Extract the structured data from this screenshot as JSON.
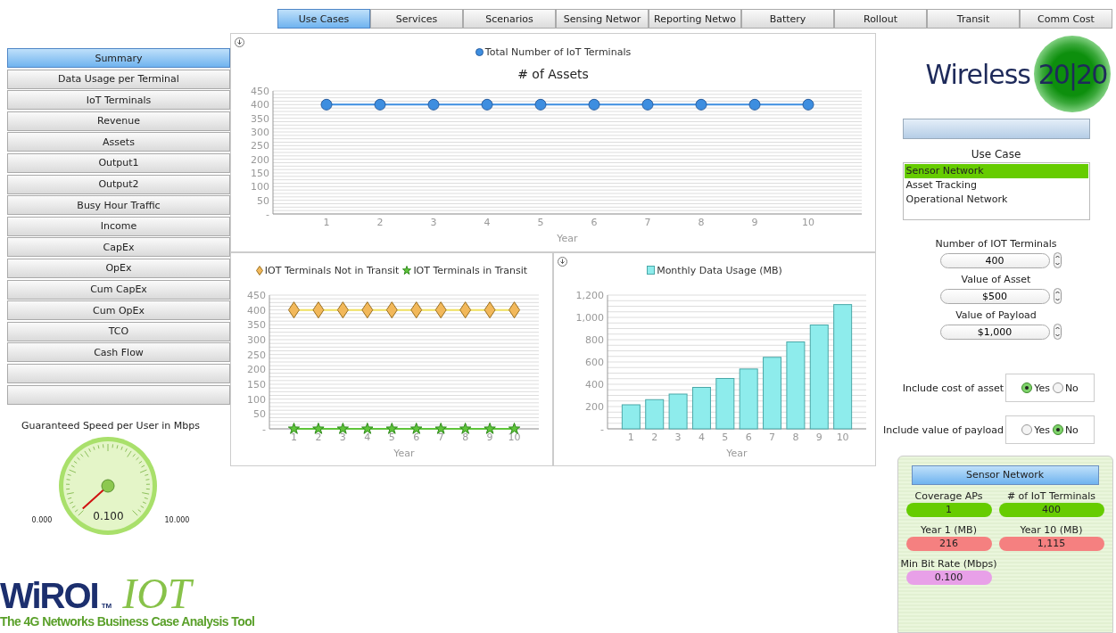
{
  "tabs": [
    {
      "label": "Use Cases",
      "selected": true
    },
    {
      "label": "Services",
      "selected": false
    },
    {
      "label": "Scenarios",
      "selected": false
    },
    {
      "label": "Sensing Networ",
      "selected": false
    },
    {
      "label": "Reporting Netwo",
      "selected": false
    },
    {
      "label": "Battery",
      "selected": false
    },
    {
      "label": "Rollout",
      "selected": false
    },
    {
      "label": "Transit",
      "selected": false
    },
    {
      "label": "Comm Cost",
      "selected": false
    }
  ],
  "sidebar": {
    "items": [
      {
        "kind": "button",
        "label": "Summary",
        "selected": true
      },
      {
        "kind": "button",
        "label": "Data Usage per Terminal",
        "selected": false
      },
      {
        "kind": "button",
        "label": "IoT Terminals",
        "selected": false
      },
      {
        "kind": "button",
        "label": "Revenue",
        "selected": false
      },
      {
        "kind": "button",
        "label": "Assets",
        "selected": false
      },
      {
        "kind": "button",
        "label": "Output1",
        "selected": false
      },
      {
        "kind": "button",
        "label": "Output2",
        "selected": false
      },
      {
        "kind": "button",
        "label": "Busy Hour Traffic",
        "selected": false
      },
      {
        "kind": "button",
        "label": "Income",
        "selected": false
      },
      {
        "kind": "button",
        "label": "CapEx",
        "selected": false
      },
      {
        "kind": "button",
        "label": "OpEx",
        "selected": false
      },
      {
        "kind": "button",
        "label": "Cum CapEx",
        "selected": false
      },
      {
        "kind": "button",
        "label": "Cum OpEx",
        "selected": false
      },
      {
        "kind": "button",
        "label": "TCO",
        "selected": false
      },
      {
        "kind": "button",
        "label": "Cash Flow",
        "selected": false
      },
      {
        "kind": "blank",
        "selected": false
      },
      {
        "kind": "blank",
        "selected": false
      }
    ]
  },
  "gauge": {
    "title": "Guaranteed Speed per User in Mbps",
    "reading": "0.100",
    "min_label": "0.000",
    "max_label": "10.000"
  },
  "product_logo": {
    "name": "WiROI",
    "trademark": "TM",
    "product": "IOT",
    "tagline": "The 4G Networks Business Case Analysis Tool"
  },
  "charts": [
    {
      "has_menu": true,
      "chart_data": {
        "type": "line",
        "title": "# of Assets",
        "grid": true,
        "xlabel": "Year",
        "categories": [
          "1",
          "2",
          "3",
          "4",
          "5",
          "6",
          "7",
          "8",
          "9",
          "10"
        ],
        "ylim": [
          0,
          450
        ],
        "yticks": [
          {
            "value": 0,
            "label": "-"
          },
          50,
          100,
          150,
          200,
          250,
          300,
          350,
          400,
          450
        ],
        "series": [
          {
            "name": "Total Number of IoT Terminals",
            "color": "#3d8ee0",
            "marker": "circle",
            "values": [
              400,
              400,
              400,
              400,
              400,
              400,
              400,
              400,
              400,
              400
            ]
          }
        ]
      }
    },
    {
      "has_menu": false,
      "chart_data": {
        "type": "line",
        "grid": true,
        "xlabel": "Year",
        "categories": [
          "1",
          "2",
          "3",
          "4",
          "5",
          "6",
          "7",
          "8",
          "9",
          "10"
        ],
        "ylim": [
          0,
          450
        ],
        "yticks": [
          {
            "value": 0,
            "label": "-"
          },
          50,
          100,
          150,
          200,
          250,
          300,
          350,
          400,
          450
        ],
        "series": [
          {
            "name": "IOT Terminals Not in Transit",
            "color": "#f0e060",
            "marker": "diamond",
            "values": [
              400,
              400,
              400,
              400,
              400,
              400,
              400,
              400,
              400,
              400
            ]
          },
          {
            "name": "IOT Terminals in Transit",
            "color": "#5fc43a",
            "marker": "star",
            "values": [
              0,
              0,
              0,
              0,
              0,
              0,
              0,
              0,
              0,
              0
            ]
          }
        ]
      }
    },
    {
      "has_menu": true,
      "chart_data": {
        "type": "bar",
        "grid": true,
        "xlabel": "Year",
        "categories": [
          "1",
          "2",
          "3",
          "4",
          "5",
          "6",
          "7",
          "8",
          "9",
          "10"
        ],
        "ylim": [
          0,
          1200
        ],
        "yticks": [
          {
            "value": 0,
            "label": "-"
          },
          200,
          400,
          600,
          800,
          {
            "value": 1000,
            "label": "1,000"
          },
          {
            "value": 1200,
            "label": "1,200"
          }
        ],
        "series": [
          {
            "name": "Monthly Data Usage (MB)",
            "color": "#8eecec",
            "values": [
              216,
              262,
              312,
              372,
              452,
              537,
              642,
              780,
              932,
              1115
            ]
          }
        ]
      }
    }
  ],
  "brand_logo": {
    "name": "Wireless",
    "mark": "20|20"
  },
  "use_case": {
    "label": "Use Case",
    "options": [
      {
        "label": "Sensor Network",
        "selected": true
      },
      {
        "label": "Asset Tracking",
        "selected": false
      },
      {
        "label": "Operational Network",
        "selected": false
      }
    ]
  },
  "fields": [
    {
      "label": "Number of IOT Terminals",
      "value": "400"
    },
    {
      "label": "Value of Asset",
      "value": "$500"
    },
    {
      "label": "Value of Payload",
      "value": "$1,000"
    }
  ],
  "options": [
    {
      "label": "Include cost of asset",
      "choices": [
        {
          "label": "Yes",
          "selected": true
        },
        {
          "label": "No",
          "selected": false
        }
      ]
    },
    {
      "label": "Include value of payload",
      "choices": [
        {
          "label": "Yes",
          "selected": false
        },
        {
          "label": "No",
          "selected": true
        }
      ]
    }
  ],
  "summary_card": {
    "title": "Sensor Network",
    "metrics": [
      {
        "label": "Coverage APs",
        "value": "1",
        "color": "#66cc00"
      },
      {
        "label": "# of IoT Terminals",
        "value": "400",
        "color": "#66cc00"
      },
      {
        "label": "Year 1 (MB)",
        "value": "216",
        "color": "#f58080"
      },
      {
        "label": "Year 10 (MB)",
        "value": "1,115",
        "color": "#f58080"
      },
      {
        "label": "Min Bit Rate (Mbps)",
        "value": "0.100",
        "color": "#e8a0e8"
      }
    ]
  }
}
